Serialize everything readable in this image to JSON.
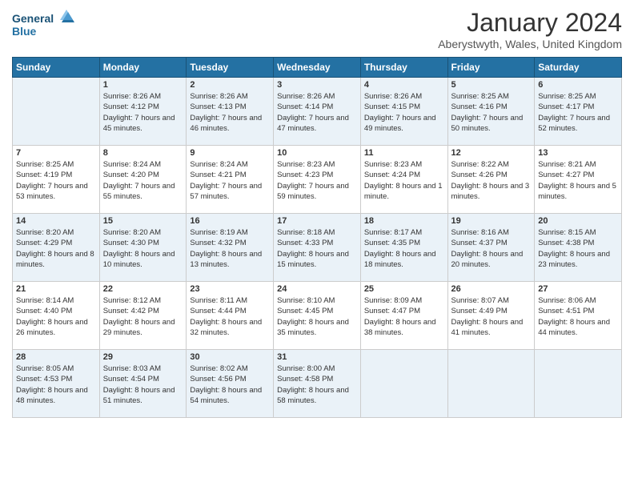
{
  "logo": {
    "line1": "General",
    "line2": "Blue"
  },
  "title": "January 2024",
  "location": "Aberystwyth, Wales, United Kingdom",
  "weekdays": [
    "Sunday",
    "Monday",
    "Tuesday",
    "Wednesday",
    "Thursday",
    "Friday",
    "Saturday"
  ],
  "weeks": [
    [
      {
        "day": "",
        "sunrise": "",
        "sunset": "",
        "daylight": ""
      },
      {
        "day": "1",
        "sunrise": "Sunrise: 8:26 AM",
        "sunset": "Sunset: 4:12 PM",
        "daylight": "Daylight: 7 hours and 45 minutes."
      },
      {
        "day": "2",
        "sunrise": "Sunrise: 8:26 AM",
        "sunset": "Sunset: 4:13 PM",
        "daylight": "Daylight: 7 hours and 46 minutes."
      },
      {
        "day": "3",
        "sunrise": "Sunrise: 8:26 AM",
        "sunset": "Sunset: 4:14 PM",
        "daylight": "Daylight: 7 hours and 47 minutes."
      },
      {
        "day": "4",
        "sunrise": "Sunrise: 8:26 AM",
        "sunset": "Sunset: 4:15 PM",
        "daylight": "Daylight: 7 hours and 49 minutes."
      },
      {
        "day": "5",
        "sunrise": "Sunrise: 8:25 AM",
        "sunset": "Sunset: 4:16 PM",
        "daylight": "Daylight: 7 hours and 50 minutes."
      },
      {
        "day": "6",
        "sunrise": "Sunrise: 8:25 AM",
        "sunset": "Sunset: 4:17 PM",
        "daylight": "Daylight: 7 hours and 52 minutes."
      }
    ],
    [
      {
        "day": "7",
        "sunrise": "Sunrise: 8:25 AM",
        "sunset": "Sunset: 4:19 PM",
        "daylight": "Daylight: 7 hours and 53 minutes."
      },
      {
        "day": "8",
        "sunrise": "Sunrise: 8:24 AM",
        "sunset": "Sunset: 4:20 PM",
        "daylight": "Daylight: 7 hours and 55 minutes."
      },
      {
        "day": "9",
        "sunrise": "Sunrise: 8:24 AM",
        "sunset": "Sunset: 4:21 PM",
        "daylight": "Daylight: 7 hours and 57 minutes."
      },
      {
        "day": "10",
        "sunrise": "Sunrise: 8:23 AM",
        "sunset": "Sunset: 4:23 PM",
        "daylight": "Daylight: 7 hours and 59 minutes."
      },
      {
        "day": "11",
        "sunrise": "Sunrise: 8:23 AM",
        "sunset": "Sunset: 4:24 PM",
        "daylight": "Daylight: 8 hours and 1 minute."
      },
      {
        "day": "12",
        "sunrise": "Sunrise: 8:22 AM",
        "sunset": "Sunset: 4:26 PM",
        "daylight": "Daylight: 8 hours and 3 minutes."
      },
      {
        "day": "13",
        "sunrise": "Sunrise: 8:21 AM",
        "sunset": "Sunset: 4:27 PM",
        "daylight": "Daylight: 8 hours and 5 minutes."
      }
    ],
    [
      {
        "day": "14",
        "sunrise": "Sunrise: 8:20 AM",
        "sunset": "Sunset: 4:29 PM",
        "daylight": "Daylight: 8 hours and 8 minutes."
      },
      {
        "day": "15",
        "sunrise": "Sunrise: 8:20 AM",
        "sunset": "Sunset: 4:30 PM",
        "daylight": "Daylight: 8 hours and 10 minutes."
      },
      {
        "day": "16",
        "sunrise": "Sunrise: 8:19 AM",
        "sunset": "Sunset: 4:32 PM",
        "daylight": "Daylight: 8 hours and 13 minutes."
      },
      {
        "day": "17",
        "sunrise": "Sunrise: 8:18 AM",
        "sunset": "Sunset: 4:33 PM",
        "daylight": "Daylight: 8 hours and 15 minutes."
      },
      {
        "day": "18",
        "sunrise": "Sunrise: 8:17 AM",
        "sunset": "Sunset: 4:35 PM",
        "daylight": "Daylight: 8 hours and 18 minutes."
      },
      {
        "day": "19",
        "sunrise": "Sunrise: 8:16 AM",
        "sunset": "Sunset: 4:37 PM",
        "daylight": "Daylight: 8 hours and 20 minutes."
      },
      {
        "day": "20",
        "sunrise": "Sunrise: 8:15 AM",
        "sunset": "Sunset: 4:38 PM",
        "daylight": "Daylight: 8 hours and 23 minutes."
      }
    ],
    [
      {
        "day": "21",
        "sunrise": "Sunrise: 8:14 AM",
        "sunset": "Sunset: 4:40 PM",
        "daylight": "Daylight: 8 hours and 26 minutes."
      },
      {
        "day": "22",
        "sunrise": "Sunrise: 8:12 AM",
        "sunset": "Sunset: 4:42 PM",
        "daylight": "Daylight: 8 hours and 29 minutes."
      },
      {
        "day": "23",
        "sunrise": "Sunrise: 8:11 AM",
        "sunset": "Sunset: 4:44 PM",
        "daylight": "Daylight: 8 hours and 32 minutes."
      },
      {
        "day": "24",
        "sunrise": "Sunrise: 8:10 AM",
        "sunset": "Sunset: 4:45 PM",
        "daylight": "Daylight: 8 hours and 35 minutes."
      },
      {
        "day": "25",
        "sunrise": "Sunrise: 8:09 AM",
        "sunset": "Sunset: 4:47 PM",
        "daylight": "Daylight: 8 hours and 38 minutes."
      },
      {
        "day": "26",
        "sunrise": "Sunrise: 8:07 AM",
        "sunset": "Sunset: 4:49 PM",
        "daylight": "Daylight: 8 hours and 41 minutes."
      },
      {
        "day": "27",
        "sunrise": "Sunrise: 8:06 AM",
        "sunset": "Sunset: 4:51 PM",
        "daylight": "Daylight: 8 hours and 44 minutes."
      }
    ],
    [
      {
        "day": "28",
        "sunrise": "Sunrise: 8:05 AM",
        "sunset": "Sunset: 4:53 PM",
        "daylight": "Daylight: 8 hours and 48 minutes."
      },
      {
        "day": "29",
        "sunrise": "Sunrise: 8:03 AM",
        "sunset": "Sunset: 4:54 PM",
        "daylight": "Daylight: 8 hours and 51 minutes."
      },
      {
        "day": "30",
        "sunrise": "Sunrise: 8:02 AM",
        "sunset": "Sunset: 4:56 PM",
        "daylight": "Daylight: 8 hours and 54 minutes."
      },
      {
        "day": "31",
        "sunrise": "Sunrise: 8:00 AM",
        "sunset": "Sunset: 4:58 PM",
        "daylight": "Daylight: 8 hours and 58 minutes."
      },
      {
        "day": "",
        "sunrise": "",
        "sunset": "",
        "daylight": ""
      },
      {
        "day": "",
        "sunrise": "",
        "sunset": "",
        "daylight": ""
      },
      {
        "day": "",
        "sunrise": "",
        "sunset": "",
        "daylight": ""
      }
    ]
  ]
}
